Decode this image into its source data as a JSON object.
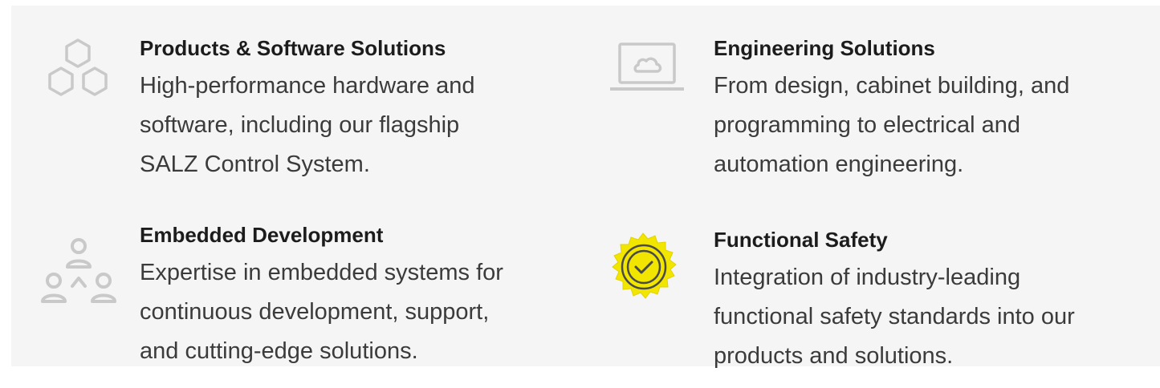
{
  "features": [
    {
      "icon": "hexagons-icon",
      "title": "Products & Software Solutions",
      "lines": [
        "High-performance hardware and",
        "software, including our flagship",
        "SALZ Control System."
      ]
    },
    {
      "icon": "laptop-cloud-icon",
      "title": "Engineering Solutions",
      "lines": [
        "From  design, cabinet building, and",
        "programming to electrical and",
        "automation engineering."
      ]
    },
    {
      "icon": "people-network-icon",
      "title": "Embedded Development",
      "lines": [
        "Expertise in embedded systems for",
        "continuous development, support,",
        "and cutting-edge solutions."
      ]
    },
    {
      "icon": "certified-badge-icon",
      "title": "Functional Safety",
      "lines": [
        "Integration of industry-leading",
        "functional safety standards into our",
        "products and solutions."
      ]
    }
  ],
  "colors": {
    "background": "#f5f5f5",
    "icon_gray": "#c9c9c9",
    "badge_yellow": "#f2e600",
    "title": "#1c1c1c",
    "text": "#3b3b3b"
  }
}
